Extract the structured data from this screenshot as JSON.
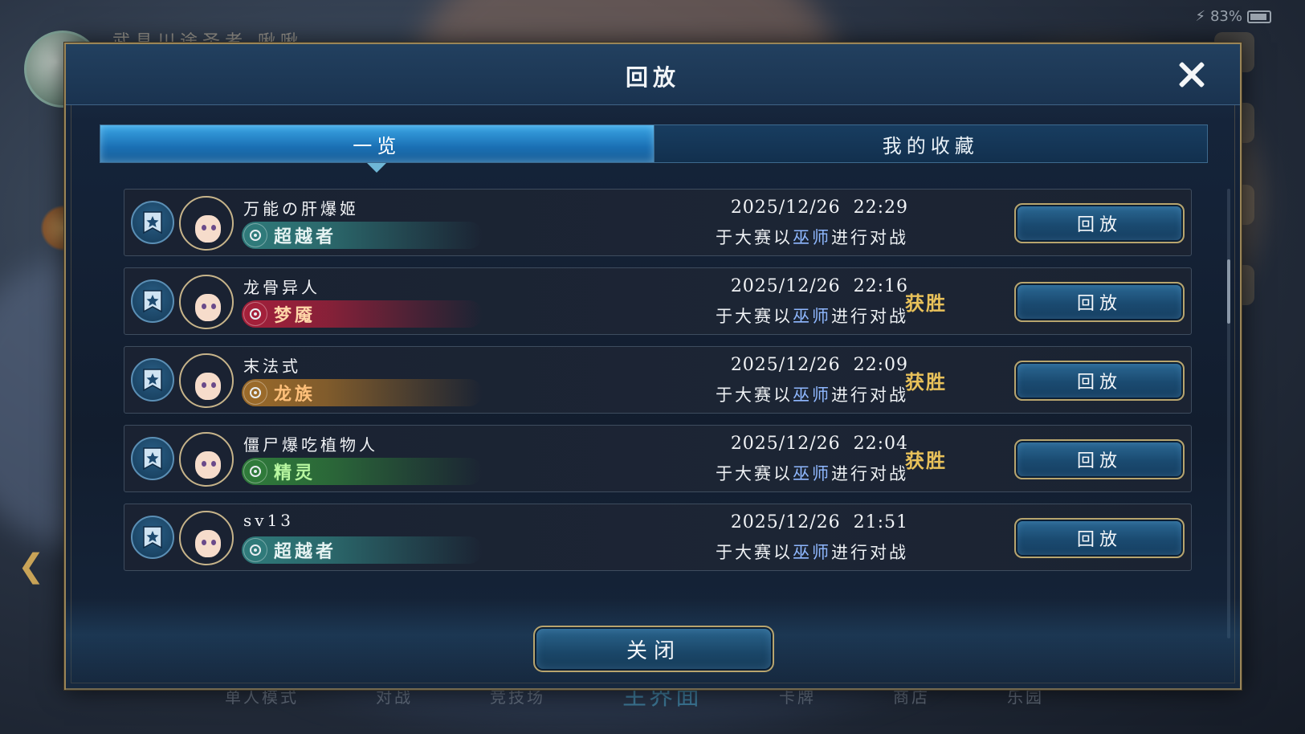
{
  "status": {
    "battery": "83%"
  },
  "background": {
    "top_title": "武具川途圣者  啾啾",
    "bottom_nav": [
      "单人模式",
      "对战",
      "竞技场",
      "主界面",
      "卡牌",
      "商店",
      "乐园"
    ]
  },
  "dialog": {
    "title": "回放",
    "tabs": [
      {
        "label": "一览",
        "active": true
      },
      {
        "label": "我的收藏",
        "active": false
      }
    ],
    "close_label": "关闭"
  },
  "replays": [
    {
      "deck": "万能の肝爆姬",
      "class": "超越者",
      "class_icon": "portalcraft-icon",
      "class_color": "#2f7a7a",
      "date": "2025/12/26  22:29",
      "desc_pre": "于大赛以",
      "desc_class": "巫师",
      "desc_post": "进行对战",
      "result": "",
      "button": "回放"
    },
    {
      "deck": "龙骨异人",
      "class": "梦魇",
      "class_icon": "bloodcraft-icon",
      "class_color": "#a3203a",
      "date": "2025/12/26  22:16",
      "desc_pre": "于大赛以",
      "desc_class": "巫师",
      "desc_post": "进行对战",
      "result": "获胜",
      "button": "回放"
    },
    {
      "deck": "末法式",
      "class": "龙族",
      "class_icon": "dragoncraft-icon",
      "class_color": "#9a6a2a",
      "date": "2025/12/26  22:09",
      "desc_pre": "于大赛以",
      "desc_class": "巫师",
      "desc_post": "进行对战",
      "result": "获胜",
      "button": "回放"
    },
    {
      "deck": "僵尸爆吃植物人",
      "class": "精灵",
      "class_icon": "forestcraft-icon",
      "class_color": "#2f7a3a",
      "date": "2025/12/26  22:04",
      "desc_pre": "于大赛以",
      "desc_class": "巫师",
      "desc_post": "进行对战",
      "result": "获胜",
      "button": "回放"
    },
    {
      "deck": "sv13",
      "class": "超越者",
      "class_icon": "portalcraft-icon",
      "class_color": "#2f7a7a",
      "date": "2025/12/26  21:51",
      "desc_pre": "于大赛以",
      "desc_class": "巫师",
      "desc_post": "进行对战",
      "result": "",
      "button": "回放"
    }
  ]
}
